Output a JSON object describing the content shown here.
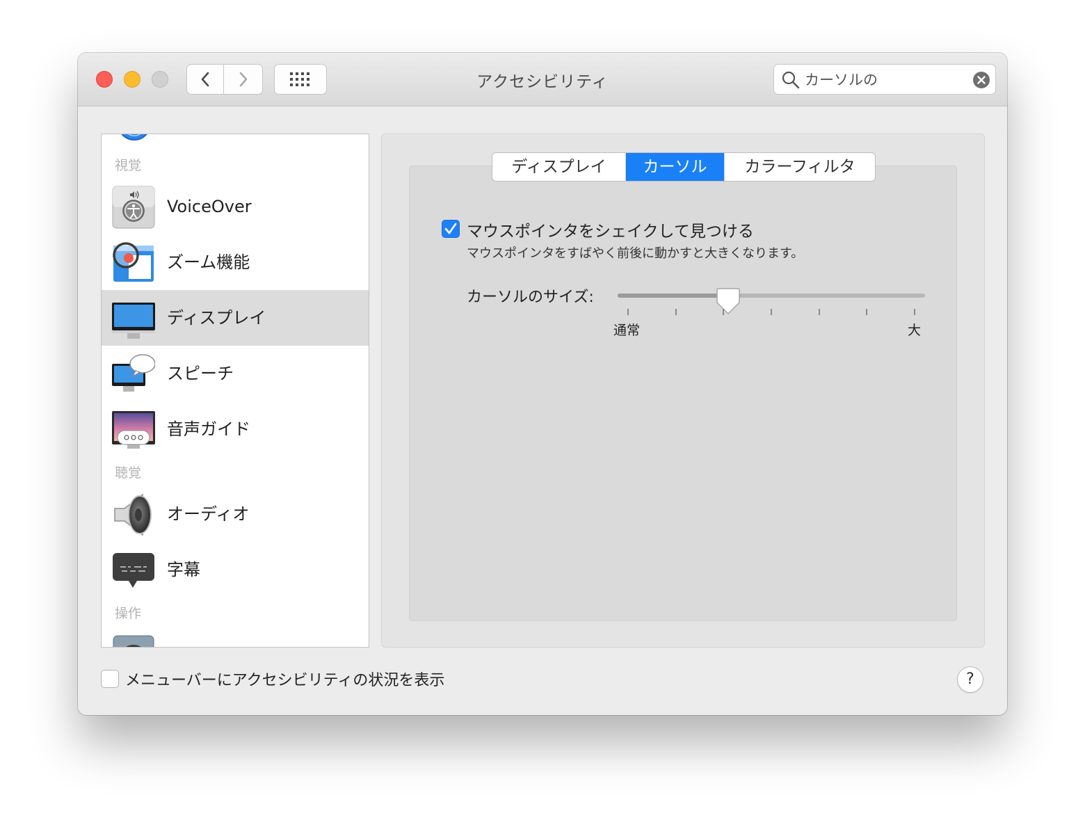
{
  "window": {
    "title": "アクセシビリティ"
  },
  "search": {
    "value": "カーソルの"
  },
  "sidebar": {
    "sections": [
      {
        "label": "視覚"
      },
      {
        "label": "聴覚"
      },
      {
        "label": "操作"
      }
    ],
    "items": [
      {
        "label": "VoiceOver",
        "icon": "voiceover-icon"
      },
      {
        "label": "ズーム機能",
        "icon": "zoom-icon"
      },
      {
        "label": "ディスプレイ",
        "icon": "display-icon",
        "selected": true
      },
      {
        "label": "スピーチ",
        "icon": "speech-icon"
      },
      {
        "label": "音声ガイド",
        "icon": "descriptions-icon"
      },
      {
        "label": "オーディオ",
        "icon": "speaker-icon"
      },
      {
        "label": "字幕",
        "icon": "captions-icon"
      }
    ]
  },
  "tabs": [
    {
      "label": "ディスプレイ"
    },
    {
      "label": "カーソル",
      "active": true
    },
    {
      "label": "カラーフィルタ"
    }
  ],
  "cursor_panel": {
    "shake_option": {
      "label": "マウスポインタをシェイクして見つける",
      "description": "マウスポインタをすばやく前後に動かすと大きくなります。",
      "checked": true
    },
    "size_slider": {
      "label": "カーソルのサイズ:",
      "min_label": "通常",
      "max_label": "大",
      "value_fraction": 0.35,
      "tick_count": 7
    }
  },
  "footer": {
    "menu_bar_status_label": "メニューバーにアクセシビリティの状況を表示",
    "menu_bar_status_checked": false,
    "help_label": "?"
  },
  "colors": {
    "accent": "#1a80f7",
    "close": "#fc5f57",
    "minimize": "#fdbc2e"
  }
}
